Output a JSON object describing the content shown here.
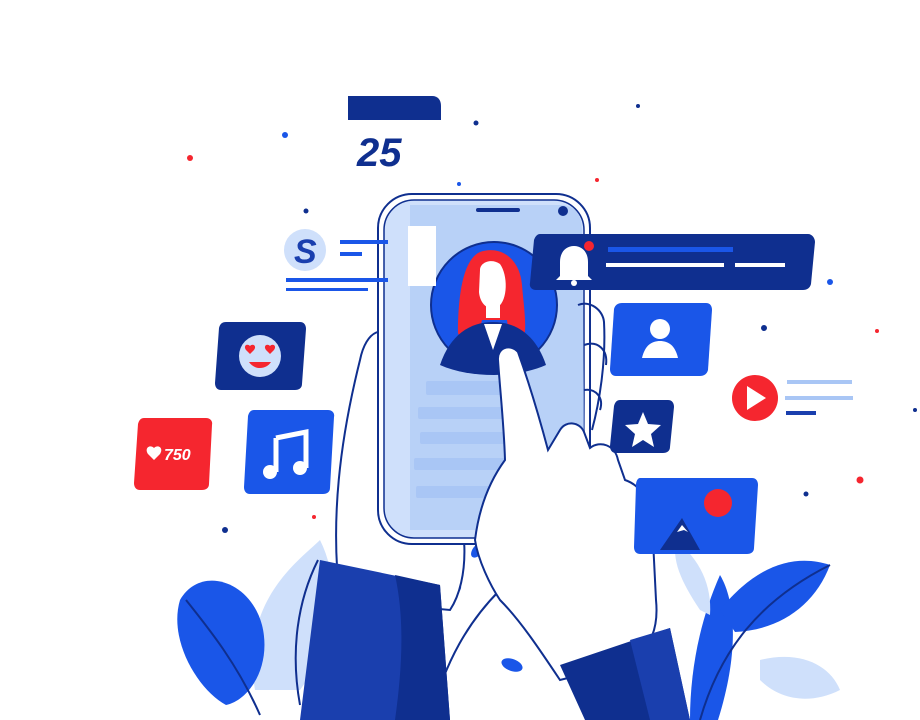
{
  "colors": {
    "dark_blue": "#0f2f8f",
    "blue": "#1a56e8",
    "light_blue": "#a9c6f5",
    "pale_blue": "#cfe0fb",
    "red": "#f5262f",
    "white": "#ffffff"
  },
  "calendar": {
    "day": "25"
  },
  "profile_card": {
    "letter": "S"
  },
  "likes_badge": {
    "count": "750"
  },
  "icons": [
    "calendar-icon",
    "bell-icon",
    "user-icon",
    "star-icon",
    "play-icon",
    "music-note-icon",
    "emoji-heart-eyes-icon",
    "heart-icon",
    "image-icon"
  ]
}
